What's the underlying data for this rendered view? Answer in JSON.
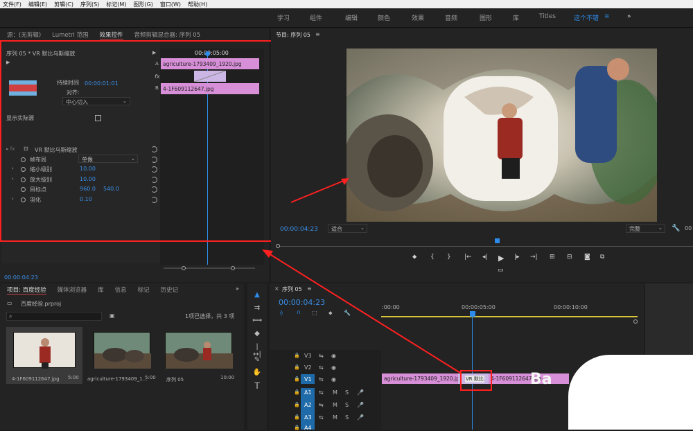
{
  "menu": [
    "文件(F)",
    "编辑(E)",
    "剪辑(C)",
    "序列(S)",
    "标记(M)",
    "图形(G)",
    "窗口(W)",
    "帮助(H)"
  ],
  "workspaces": [
    "学习",
    "组件",
    "编辑",
    "颜色",
    "效果",
    "音频",
    "图形",
    "库",
    "Titles",
    "这个不错"
  ],
  "workspace_more": "≡",
  "workspace_overflow": "»",
  "source_tabs": {
    "source": "源：(无剪辑)",
    "lumetri": "Lumetri 范围",
    "effect_controls": "效果控件",
    "audio_mixer": "音频剪辑混合器: 序列 05"
  },
  "effect_controls": {
    "header": "序列 05 * VR 默比乌斯缩放",
    "ruler_time": "00:00:05:00",
    "clip_a": "agriculture-1793409_1920.jpg",
    "clip_b": "4-1F609112647.jpg",
    "duration_label": "持续时间",
    "duration_value": "00:00:01:01",
    "align_label": "对齐:",
    "align_value": "中心切入",
    "show_source": "显示实际源",
    "effect_name": "VR 默比乌斯缩放",
    "params": [
      {
        "label": "帧布局",
        "value": "单像"
      },
      {
        "label": "缩小级别",
        "value": "10.00"
      },
      {
        "label": "放大级别",
        "value": "10.00"
      },
      {
        "label": "目标点",
        "value": "960.0",
        "value2": "540.0"
      },
      {
        "label": "羽化",
        "value": "0.10"
      }
    ],
    "timecode": "00:00:04:23"
  },
  "program": {
    "title": "节目: 序列 05",
    "timecode": "00:00:04:23",
    "fit": "适合",
    "quality": "完整",
    "right_timecode": "00"
  },
  "project": {
    "tabs": [
      "项目: 百度经验",
      "媒体浏览器",
      "库",
      "信息",
      "标记",
      "历史记"
    ],
    "file": "百度经验.prproj",
    "selection": "1项已选择，共 3 项",
    "items": [
      {
        "name": "4-1F609112647.jpg",
        "duration": "5:00"
      },
      {
        "name": "agriculture-1793409_1...",
        "duration": "5:00"
      },
      {
        "name": "序列 05",
        "duration": "10:00"
      }
    ]
  },
  "timeline": {
    "title": "序列 05",
    "timecode": "00:00:04:23",
    "ruler": [
      ":00:00",
      "00:00:05:00",
      "00:00:10:00"
    ],
    "video_tracks": [
      "V3",
      "V2",
      "V1"
    ],
    "audio_tracks": [
      "A1",
      "A2",
      "A3",
      "A4"
    ],
    "clip_a": "agriculture-1793409_1920.jpg",
    "transition": "VR 默比",
    "clip_b": "4-1F609112647.jpg",
    "ghost_text": "Ba"
  },
  "colors": {
    "accent": "#2d8ceb",
    "clip": "#d78fd7",
    "highlight": "#ff2020"
  }
}
